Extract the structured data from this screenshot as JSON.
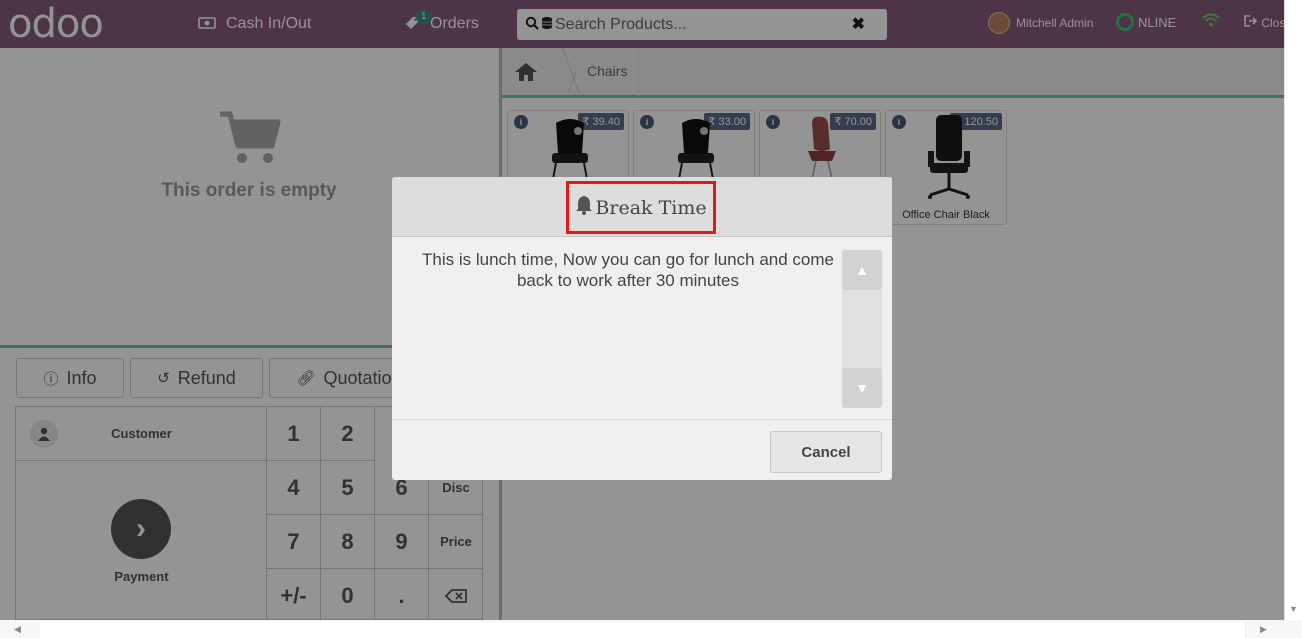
{
  "header": {
    "logo": "odoo",
    "cash_label": "Cash In/Out",
    "orders_label": "Orders",
    "orders_badge": "1",
    "search_placeholder": "Search Products...",
    "user_name": "Mitchell Admin",
    "status_label": "NLINE",
    "close_label": "Close"
  },
  "order": {
    "empty_message": "This order is empty"
  },
  "controls": {
    "info_label": "Info",
    "refund_label": "Refund",
    "quotation_label": "Quotation"
  },
  "pad": {
    "customer_label": "Customer",
    "payment_label": "Payment",
    "keys": [
      "1",
      "2",
      "4",
      "5",
      "6",
      "Disc",
      "7",
      "8",
      "9",
      "Price",
      "+/-",
      "0",
      "."
    ]
  },
  "breadcrumb": {
    "category": "Chairs"
  },
  "products": [
    {
      "price": "₹ 39.40",
      "name": ""
    },
    {
      "price": "₹ 33.00",
      "name": ""
    },
    {
      "price": "₹ 70.00",
      "name": ""
    },
    {
      "price": "₹ 120.50",
      "name": "Office Chair Black"
    }
  ],
  "dialog": {
    "title": "Break Time",
    "message": "This is lunch time, Now you can go for lunch and come back to work after 30 minutes",
    "cancel_label": "Cancel"
  },
  "icons": {
    "cash": "money-icon",
    "orders": "tag-icon",
    "search": "search-icon",
    "clear": "times-icon",
    "home": "home-icon",
    "bell": "bell-icon",
    "cart": "cart-icon"
  },
  "colors": {
    "brand": "#875a7b",
    "accent_green": "#6ec89b",
    "highlight_red": "#e01a1a"
  }
}
